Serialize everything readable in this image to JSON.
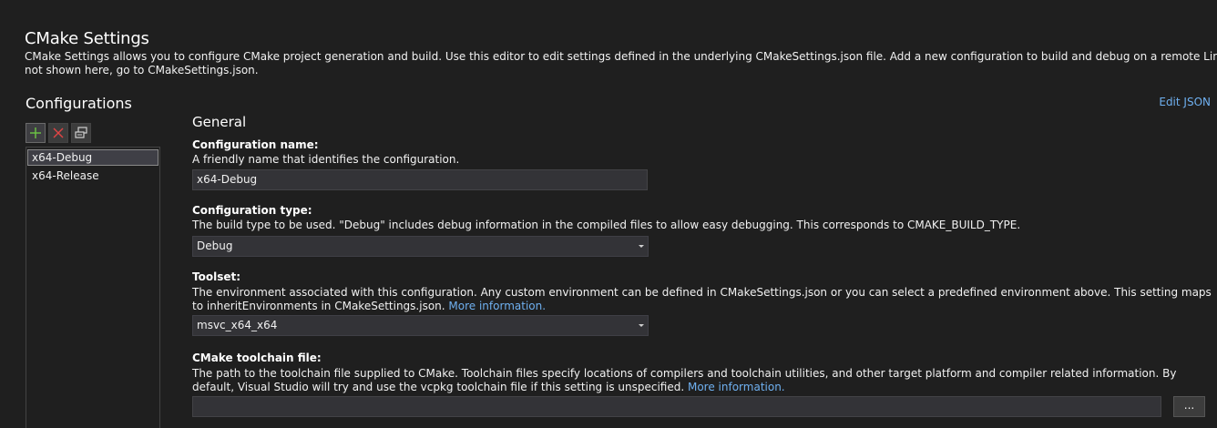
{
  "header": {
    "title": "CMake Settings",
    "description_line1": "CMake Settings allows you to configure CMake project generation and build. Use this editor to edit settings defined in the underlying CMakeSettings.json file. Add a new configuration to build and debug on a remote Linux machine or the Windows S",
    "description_line2": "not shown here, go to CMakeSettings.json."
  },
  "sidebar": {
    "title": "Configurations",
    "toolbar": [
      {
        "name": "add-icon",
        "color": "#6cc644"
      },
      {
        "name": "delete-icon",
        "color": "#e04444"
      },
      {
        "name": "copy-icon",
        "color": "#d0d0d0"
      }
    ],
    "items": [
      {
        "label": "x64-Debug",
        "selected": true
      },
      {
        "label": "x64-Release",
        "selected": false
      }
    ]
  },
  "main": {
    "edit_json_label": "Edit JSON",
    "section_title": "General",
    "config_name": {
      "label": "Configuration name:",
      "help": "A friendly name that identifies the configuration.",
      "value": "x64-Debug"
    },
    "config_type": {
      "label": "Configuration type:",
      "help": "The build type to be used. \"Debug\" includes debug information in the compiled files to allow easy debugging. This corresponds to CMAKE_BUILD_TYPE.",
      "value": "Debug"
    },
    "toolset": {
      "label": "Toolset:",
      "help": "The environment associated with this configuration. Any custom environment can be defined in CMakeSettings.json or you can select a predefined environment above. This setting maps to inheritEnvironments in CMakeSettings.json.",
      "link": "More information.",
      "value": "msvc_x64_x64"
    },
    "toolchain": {
      "label": "CMake toolchain file:",
      "help": "The path to the toolchain file supplied to CMake. Toolchain files specify locations of compilers and toolchain utilities, and other target platform and compiler related information. By default, Visual Studio will try and use the vcpkg toolchain file if this setting is unspecified.",
      "link": "More information.",
      "value": "",
      "browse_label": "..."
    }
  },
  "colors": {
    "background": "#1f1f1f",
    "link": "#6fb0f0",
    "input_bg": "#333337"
  }
}
